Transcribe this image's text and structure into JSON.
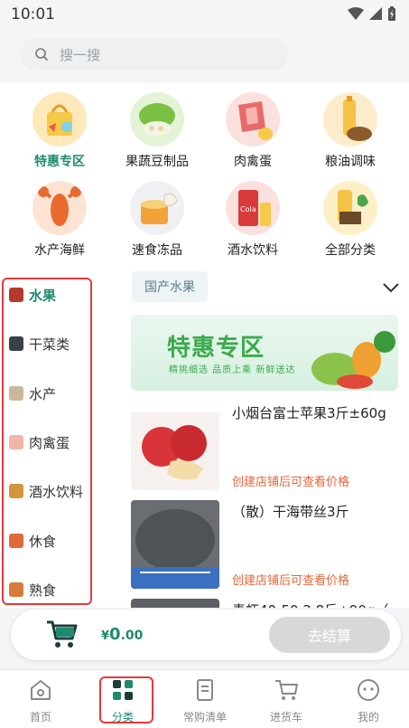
{
  "status_bar": {
    "time": "10:01"
  },
  "search": {
    "placeholder": "搜一搜"
  },
  "categories": [
    {
      "label": "特惠专区",
      "icon": "shopping-bag-icon",
      "active": true
    },
    {
      "label": "果蔬豆制品",
      "icon": "vegetable-icon",
      "active": false
    },
    {
      "label": "肉禽蛋",
      "icon": "meat-icon",
      "active": false
    },
    {
      "label": "粮油调味",
      "icon": "oil-bottle-icon",
      "active": false
    },
    {
      "label": "水产海鲜",
      "icon": "lobster-icon",
      "active": false
    },
    {
      "label": "速食冻品",
      "icon": "dumpling-icon",
      "active": false
    },
    {
      "label": "酒水饮料",
      "icon": "cola-can-icon",
      "active": false
    },
    {
      "label": "全部分类",
      "icon": "all-categories-icon",
      "active": false
    }
  ],
  "sidebar": {
    "items": [
      {
        "label": "水果",
        "icon": "fruit-icon",
        "active": true
      },
      {
        "label": "干菜类",
        "icon": "dried-veg-icon",
        "active": false
      },
      {
        "label": "水产",
        "icon": "fish-icon",
        "active": false
      },
      {
        "label": "肉禽蛋",
        "icon": "meat-icon",
        "active": false
      },
      {
        "label": "酒水饮料",
        "icon": "drink-icon",
        "active": false
      },
      {
        "label": "休食",
        "icon": "snack-icon",
        "active": false
      },
      {
        "label": "熟食",
        "icon": "cooked-food-icon",
        "active": false
      }
    ]
  },
  "content": {
    "subcategory_chip": "国产水果",
    "banner": {
      "title": "特惠专区",
      "subtitle": "精挑细选 品质上乘 新鲜送达"
    },
    "products": [
      {
        "name": "小烟台富士苹果3斤±60g",
        "price_text": "创建店铺后可查看价格",
        "thumb": "apple-photo"
      },
      {
        "name": "（散）干海带丝3斤",
        "price_text": "创建店铺后可查看价格",
        "thumb": "kelp-photo"
      },
      {
        "name": "青虾40-50 2.8斤±90g（",
        "price_text": "",
        "thumb": "shrimp-photo"
      }
    ]
  },
  "cart": {
    "currency": "¥",
    "amount_int": "0",
    "amount_dec": ".00",
    "checkout_label": "去结算"
  },
  "tabbar": {
    "items": [
      {
        "label": "首页",
        "icon": "home-icon",
        "active": false
      },
      {
        "label": "分类",
        "icon": "category-grid-icon",
        "active": true
      },
      {
        "label": "常购清单",
        "icon": "list-icon",
        "active": false
      },
      {
        "label": "进货车",
        "icon": "cart-icon",
        "active": false
      },
      {
        "label": "我的",
        "icon": "profile-icon",
        "active": false
      }
    ]
  },
  "colors": {
    "accent": "#1e8a6e",
    "price": "#e8643a",
    "highlight_box": "#e33a3a"
  }
}
